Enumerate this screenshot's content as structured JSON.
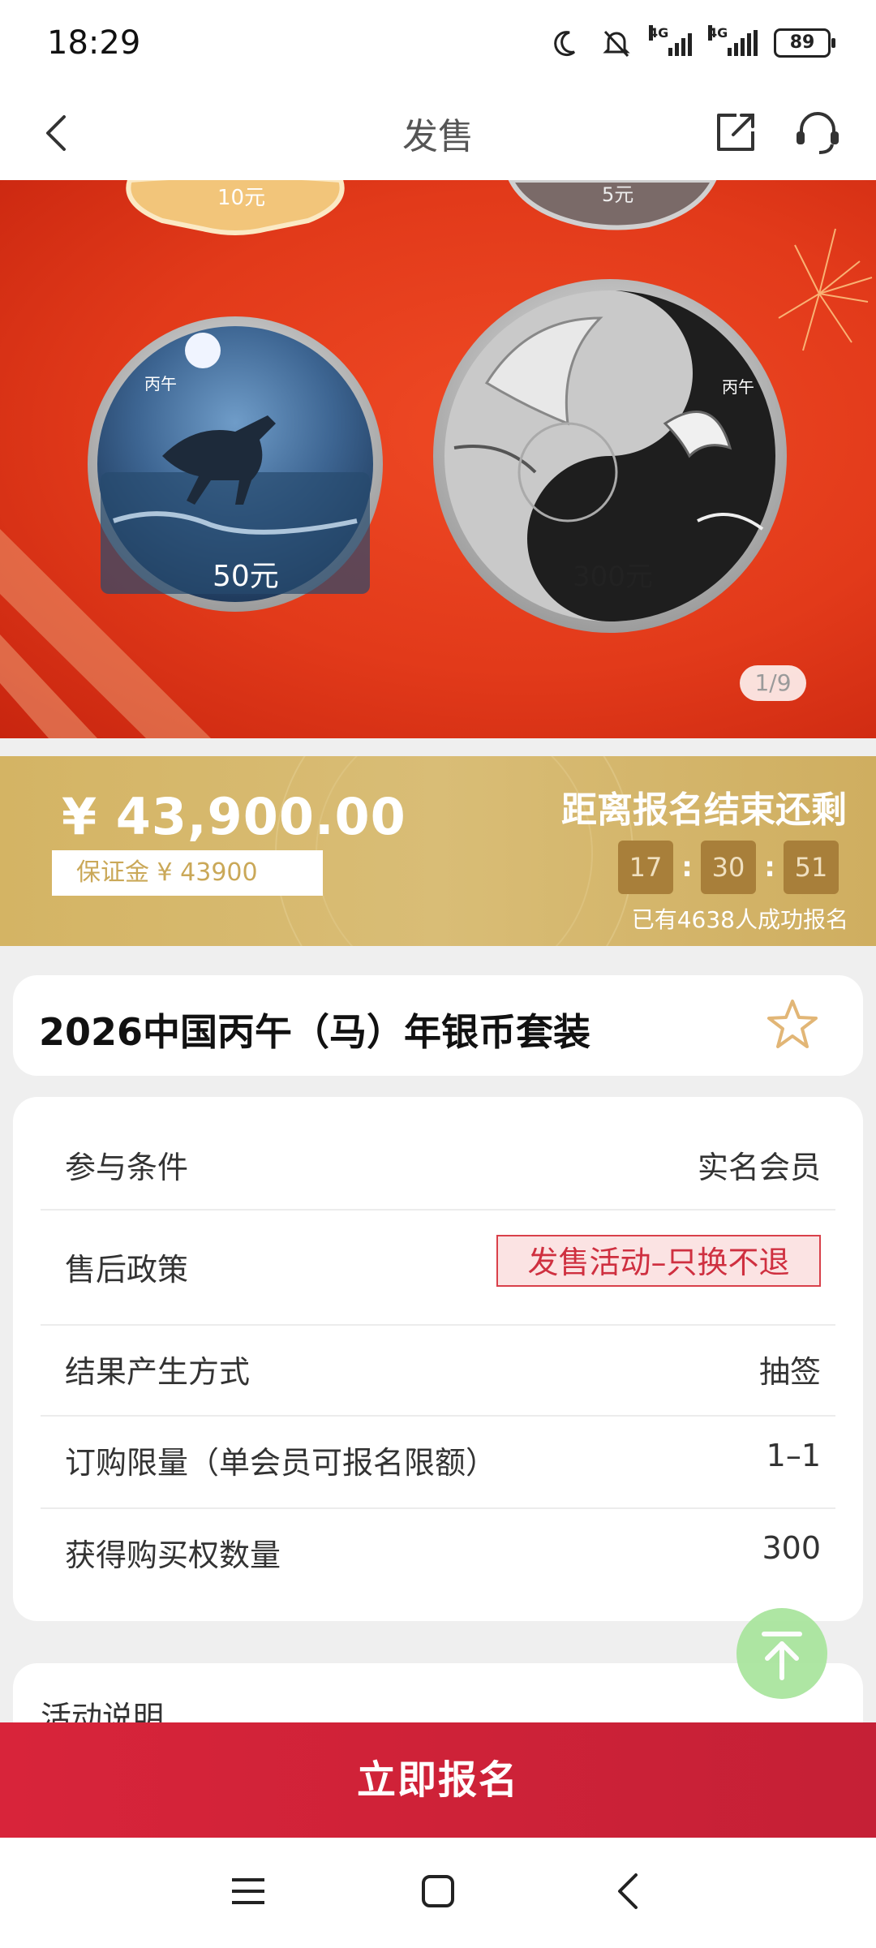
{
  "status_bar": {
    "time": "18:29",
    "network_1": "4G",
    "network_2": "4G",
    "battery": "89"
  },
  "nav": {
    "title": "发售"
  },
  "banner": {
    "page_indicator": "1/9",
    "coins": [
      {
        "denomination": "10元"
      },
      {
        "denomination": "5元"
      },
      {
        "denomination": "50元",
        "label": "丙午"
      },
      {
        "denomination": "300元",
        "label": "丙午"
      }
    ]
  },
  "sale": {
    "price": "¥ 43,900.00",
    "deposit": "保证金 ¥ 43900",
    "countdown_title": "距离报名结束还剩",
    "countdown": {
      "hours": "17",
      "minutes": "30",
      "seconds": "51"
    },
    "applied_count": "已有4638人成功报名"
  },
  "product": {
    "title": "2026中国丙午（马）年银币套装"
  },
  "info": {
    "rows": [
      {
        "label": "参与条件",
        "value": "实名会员"
      },
      {
        "label": "售后政策",
        "value": "发售活动–只换不退"
      },
      {
        "label": "结果产生方式",
        "value": "抽签"
      },
      {
        "label": "订购限量（单会员可报名限额）",
        "value": "1–1"
      },
      {
        "label": "获得购买权数量",
        "value": "300"
      }
    ]
  },
  "activity": {
    "title": "活动说明"
  },
  "cta": {
    "apply_label": "立即报名"
  },
  "colors": {
    "brand_red": "#d8243a",
    "gold": "#d4b464",
    "banner_red": "#e23a1a"
  }
}
